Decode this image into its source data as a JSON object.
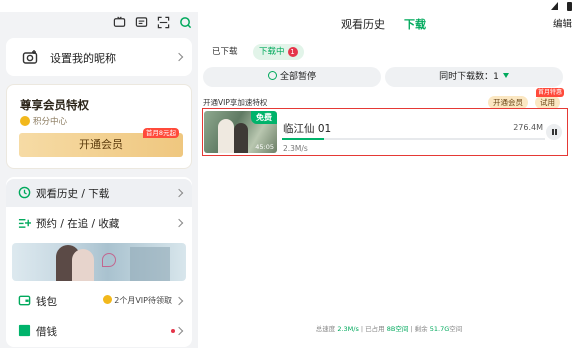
{
  "left": {
    "profile": {
      "nickname": "设置我的昵称"
    },
    "vip": {
      "title": "尊享会员特权",
      "points": "积分中心",
      "button": "开通会员",
      "badge": "首月8元起"
    },
    "menu": {
      "history": {
        "label": "观看历史 / 下载"
      },
      "follow": {
        "label": "预约 / 在追 / 收藏"
      },
      "wallet": {
        "label": "钱包",
        "extra": "2个月VIP待领取"
      },
      "loan": {
        "label": "借钱"
      }
    }
  },
  "right": {
    "tabs": {
      "history": "观看历史",
      "download": "下载"
    },
    "edit": "编辑",
    "chips": {
      "downloaded": "已下载",
      "downloading": "下载中",
      "count": "1"
    },
    "pause_all": "全部暂停",
    "concurrent": "同时下载数：1",
    "vip_tip": "开通VIP享加速特权",
    "vip_btn": "开通会员",
    "trial_btn": "试用",
    "trial_badge": "首月特惠",
    "item": {
      "title": "临江仙 01",
      "size": "276.4M",
      "speed": "2.3M/s",
      "free": "免费",
      "duration": "45:05",
      "progress": 0.16
    },
    "footer": {
      "total_label": "总速度 ",
      "total_speed": "2.3M/s",
      "used_label": " | 已占用 ",
      "used": "8B空间",
      "remain_label": " | 剩余 ",
      "remain": "51.7G",
      "remain_suffix": "空间"
    }
  },
  "colors": {
    "accent": "#00a95c",
    "highlight_border": "#e53935",
    "vip_gold": "#efc77f",
    "badge_red": "#ff4a3a"
  }
}
